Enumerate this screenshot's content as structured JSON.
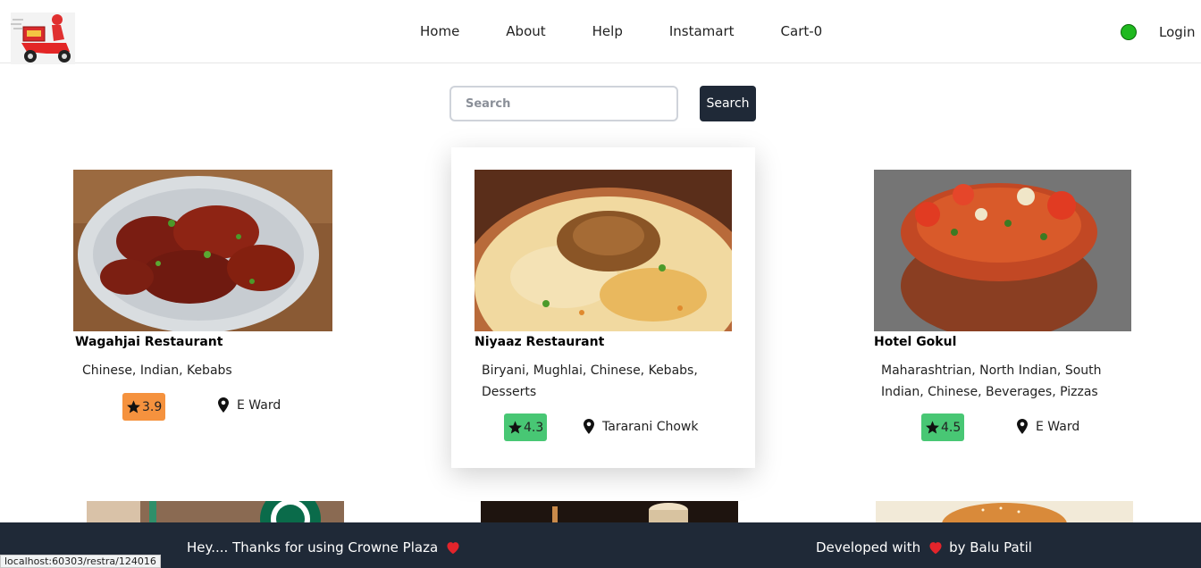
{
  "nav": {
    "items": [
      "Home",
      "About",
      "Help",
      "Instamart",
      "Cart-0"
    ],
    "login_label": "Login",
    "status_color": "#1fb91f"
  },
  "search": {
    "placeholder": "Search",
    "button_label": "Search"
  },
  "restaurants": [
    {
      "name": "Wagahjai Restaurant",
      "cuisines": "Chinese, Indian, Kebabs",
      "rating": "3.9",
      "rating_color": "#f5923e",
      "location": "E Ward"
    },
    {
      "name": "Niyaaz Restaurant",
      "cuisines": "Biryani, Mughlai, Chinese, Kebabs, Desserts",
      "rating": "4.3",
      "rating_color": "#48c774",
      "location": "Tararani Chowk"
    },
    {
      "name": "Hotel Gokul",
      "cuisines": "Maharashtrian, North Indian, South Indian, Chinese, Beverages, Pizzas",
      "rating": "4.5",
      "rating_color": "#48c774",
      "location": "E Ward"
    }
  ],
  "footer": {
    "left_text": "Hey.... Thanks for using Crowne Plaza",
    "right_prefix": "Developed with",
    "right_suffix": "by Balu Patil"
  },
  "status_bar_url": "localhost:60303/restra/124016"
}
